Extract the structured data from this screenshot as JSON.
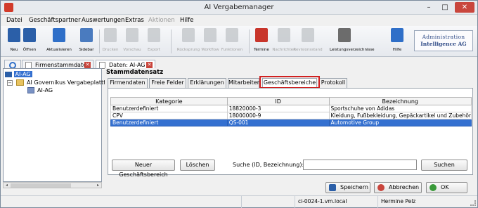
{
  "window": {
    "title": "AI Vergabemanager"
  },
  "menu": [
    {
      "label": "Datei",
      "enabled": true
    },
    {
      "label": "Geschäftspartner",
      "enabled": true
    },
    {
      "label": "Auswertungen",
      "enabled": true
    },
    {
      "label": "Extras",
      "enabled": true
    },
    {
      "label": "Aktionen",
      "enabled": false
    },
    {
      "label": "Hilfe",
      "enabled": true
    }
  ],
  "toolbar": {
    "buttons": [
      {
        "label": "Neu",
        "icon": "new-user-icon",
        "color": "#2b5fa8",
        "enabled": true
      },
      {
        "label": "Öffnen",
        "icon": "open-user-icon",
        "color": "#2b5fa8",
        "enabled": true
      },
      {
        "label": "Aktualisieren",
        "icon": "refresh-icon",
        "color": "#2f6fc8",
        "enabled": true
      },
      {
        "label": "Sidebar",
        "icon": "sidebar-icon",
        "color": "#4a7bbf",
        "enabled": true
      },
      {
        "label": "Drucken",
        "icon": "print-icon",
        "color": "#999999",
        "enabled": false
      },
      {
        "label": "Vorschau",
        "icon": "preview-icon",
        "color": "#999999",
        "enabled": false
      },
      {
        "label": "Export",
        "icon": "export-icon",
        "color": "#999999",
        "enabled": false
      },
      {
        "label": "Rücksprung",
        "icon": "back-icon",
        "color": "#999999",
        "enabled": false
      },
      {
        "label": "Workflow",
        "icon": "workflow-icon",
        "color": "#999999",
        "enabled": false
      },
      {
        "label": "Funktionen",
        "icon": "functions-icon",
        "color": "#999999",
        "enabled": false
      },
      {
        "label": "Termine",
        "icon": "calendar-icon",
        "color": "#c8352b",
        "enabled": true
      },
      {
        "label": "Nachrichten",
        "icon": "messages-icon",
        "color": "#999999",
        "enabled": false
      },
      {
        "label": "Revisionsstand",
        "icon": "revision-icon",
        "color": "#999999",
        "enabled": false
      },
      {
        "label": "Leistungsverzeichnisse",
        "icon": "catalog-icon",
        "color": "#6c6c6c",
        "enabled": true
      },
      {
        "label": "Hilfe",
        "icon": "help-icon",
        "color": "#2f6fc8",
        "enabled": true
      }
    ],
    "logo_line1": "Administration",
    "logo_line2": "Intelligence AG"
  },
  "doc_tabs": {
    "tab1": "Firmenstammdaten",
    "tab2": "Daten: AI-AG"
  },
  "tree": {
    "root": "AI-AG",
    "child": "AI Governikus Vergabeplattf",
    "grandchild": "AI-AG"
  },
  "stammdatensatz": {
    "title": "Stammdatensatz",
    "tabs": [
      "Firmendaten",
      "Freie Felder",
      "Erklärungen",
      "Mitarbeiter",
      "Geschäftsbereiche",
      "Protokoll"
    ],
    "active_tab": "Geschäftsbereiche",
    "table": {
      "headers": [
        "Kategorie",
        "ID",
        "Bezeichnung"
      ],
      "rows": [
        [
          "Benutzerdefiniert",
          "18820000-3",
          "Sportschuhe von Adidas"
        ],
        [
          "CPV",
          "18000000-9",
          "Kleidung, Fußbekleidung, Gepäckartikel und Zubehör"
        ],
        [
          "Benutzerdefiniert",
          "QS-001",
          "Automotive Group"
        ]
      ],
      "selected_row": 2
    },
    "new_button": "Neuer Geschäftsbereich",
    "delete_button": "Löschen",
    "search_label": "Suche (ID, Bezeichnung):",
    "search_value": "",
    "search_button": "Suchen"
  },
  "actions": {
    "save": "Speichern",
    "cancel": "Abbrechen",
    "ok": "OK"
  },
  "status": {
    "server": "ci-0024-1.vm.local",
    "user": "Hermine Pelz"
  }
}
